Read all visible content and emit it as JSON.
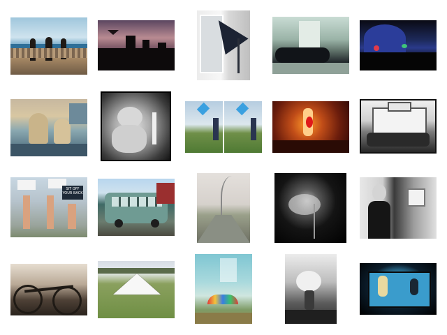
{
  "gallery": {
    "thumbnails": [
      {
        "subject": "silhouettes-at-beach"
      },
      {
        "subject": "city-skyline-at-dusk"
      },
      {
        "subject": "kite-against-window"
      },
      {
        "subject": "gallery-room-with-black-objects"
      },
      {
        "subject": "night-scene-with-colored-lights"
      },
      {
        "subject": "library-interior"
      },
      {
        "subject": "teddy-bear-black-and-white"
      },
      {
        "subject": "two-panel-people-with-kites"
      },
      {
        "subject": "warm-lit-interior-sculpture"
      },
      {
        "subject": "building-facade-black-and-white"
      },
      {
        "subject": "protesters-with-signs"
      },
      {
        "subject": "old-bus"
      },
      {
        "subject": "bridge-walkway"
      },
      {
        "subject": "dark-spotlight-figure"
      },
      {
        "subject": "woman-black-and-white"
      },
      {
        "subject": "bicycles-sepia"
      },
      {
        "subject": "kite-on-grass"
      },
      {
        "subject": "umbrella-blurred-landscape"
      },
      {
        "subject": "flowers-in-vase-black-and-white"
      },
      {
        "subject": "screen-in-dark-room"
      }
    ],
    "protest_sign_text": "SIT OFF YOUR BACK"
  }
}
